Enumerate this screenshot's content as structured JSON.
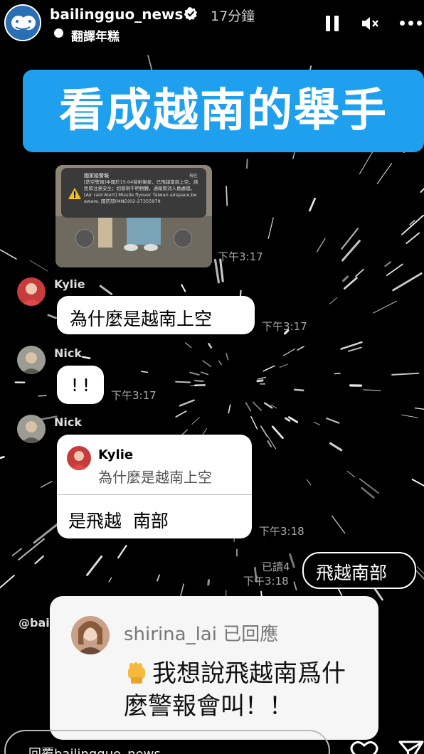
{
  "header": {
    "username": "bailingguo_news",
    "time_ago": "17分鐘",
    "translate_label": "翻譯年糕",
    "avatar_icon": "tiger-logo-icon"
  },
  "headline": "看成越南的舉手",
  "screenshot": {
    "alert_title": "國家級警報",
    "alert_time": "現在",
    "alert_body": "[防空警報]中國於15:04發射衛星，已飛越南部上空，請民眾注意安全；如發現不明物體，通報警消人員處理。[Air raid Alert] Missile flyover Taiwan airspace,be aware. 國防部(MND)02-27355979"
  },
  "chat": {
    "t1": "下午3:17",
    "kylie_name": "Kylie",
    "kylie_msg": "為什麼是越南上空",
    "t2": "下午3:17",
    "nick_name": "Nick",
    "nick_msg1": "!!",
    "t3": "下午3:17",
    "nick_name2": "Nick",
    "reply_to_name": "Kylie",
    "reply_to_msg": "為什麼是越南上空",
    "nick_msg2": "是飛越  南部",
    "t4": "下午3:18",
    "read": "已讀4",
    "t5": "下午3:18",
    "my_msg": "飛越南部"
  },
  "sticker": {
    "mention": "@bai",
    "user": "shirina_lai 已回應",
    "text": "我想說飛越南爲什麼警報會叫！！"
  },
  "footer": {
    "reply_placeholder": "回覆bailingguo_news..."
  },
  "colors": {
    "headline_bg": "#1ea0ee",
    "background": "#000000"
  }
}
